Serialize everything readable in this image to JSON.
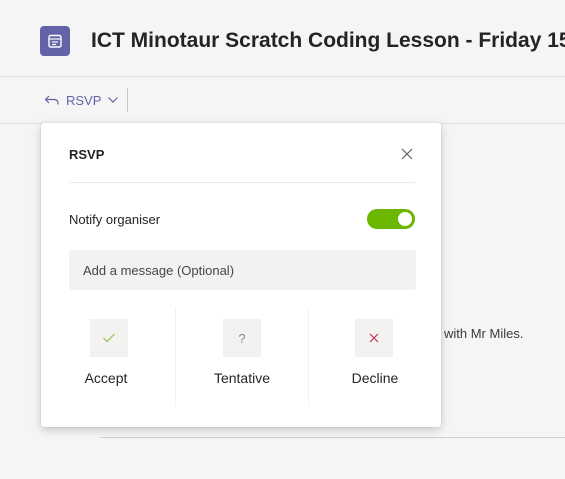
{
  "header": {
    "title": "ICT Minotaur Scratch Coding Lesson - Friday 15",
    "icon": "calendar-icon",
    "icon_color": "#6264a7"
  },
  "toolbar": {
    "rsvp_label": "RSVP",
    "rsvp_icon": "reply-arrow-icon",
    "dropdown_icon": "chevron-down-icon",
    "accent_color": "#6264a7"
  },
  "background": {
    "partial_text": "with Mr Miles."
  },
  "popup": {
    "title": "RSVP",
    "close_icon": "close-icon",
    "notify_label": "Notify organiser",
    "notify_enabled": true,
    "toggle_color": "#6bb700",
    "message_placeholder": "Add a message (Optional)",
    "message_value": "",
    "options": [
      {
        "label": "Accept",
        "icon": "checkmark-icon",
        "icon_color": "#6bb700"
      },
      {
        "label": "Tentative",
        "icon": "question-icon",
        "icon_glyph": "?",
        "icon_color": "#8a8886"
      },
      {
        "label": "Decline",
        "icon": "cross-icon",
        "icon_color": "#c4314b"
      }
    ]
  }
}
